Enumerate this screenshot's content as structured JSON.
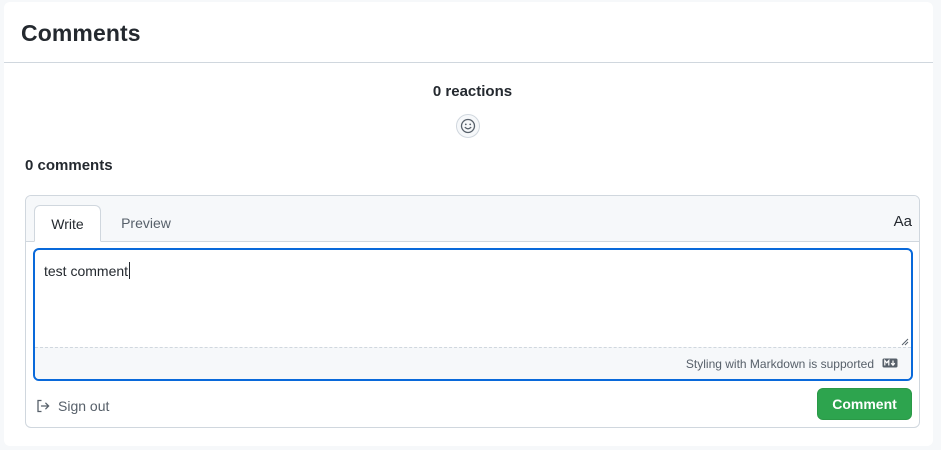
{
  "panel": {
    "title": "Comments"
  },
  "reactions": {
    "count_label": "0 reactions",
    "button_icon": "smiley-icon"
  },
  "comments": {
    "count_label": "0 comments"
  },
  "editor": {
    "tabs": [
      {
        "label": "Write",
        "active": true
      },
      {
        "label": "Preview",
        "active": false
      }
    ],
    "font_toggle_label": "Aa",
    "textarea_value": "test comment",
    "markdown_hint": "Styling with Markdown is supported",
    "markdown_icon": "markdown-icon"
  },
  "actions": {
    "signout_label": "Sign out",
    "signout_icon": "sign-out-icon",
    "comment_label": "Comment"
  },
  "colors": {
    "accent_blue": "#0969da",
    "primary_green": "#2da44e",
    "border": "#d0d7de",
    "muted_text": "#57606a"
  }
}
